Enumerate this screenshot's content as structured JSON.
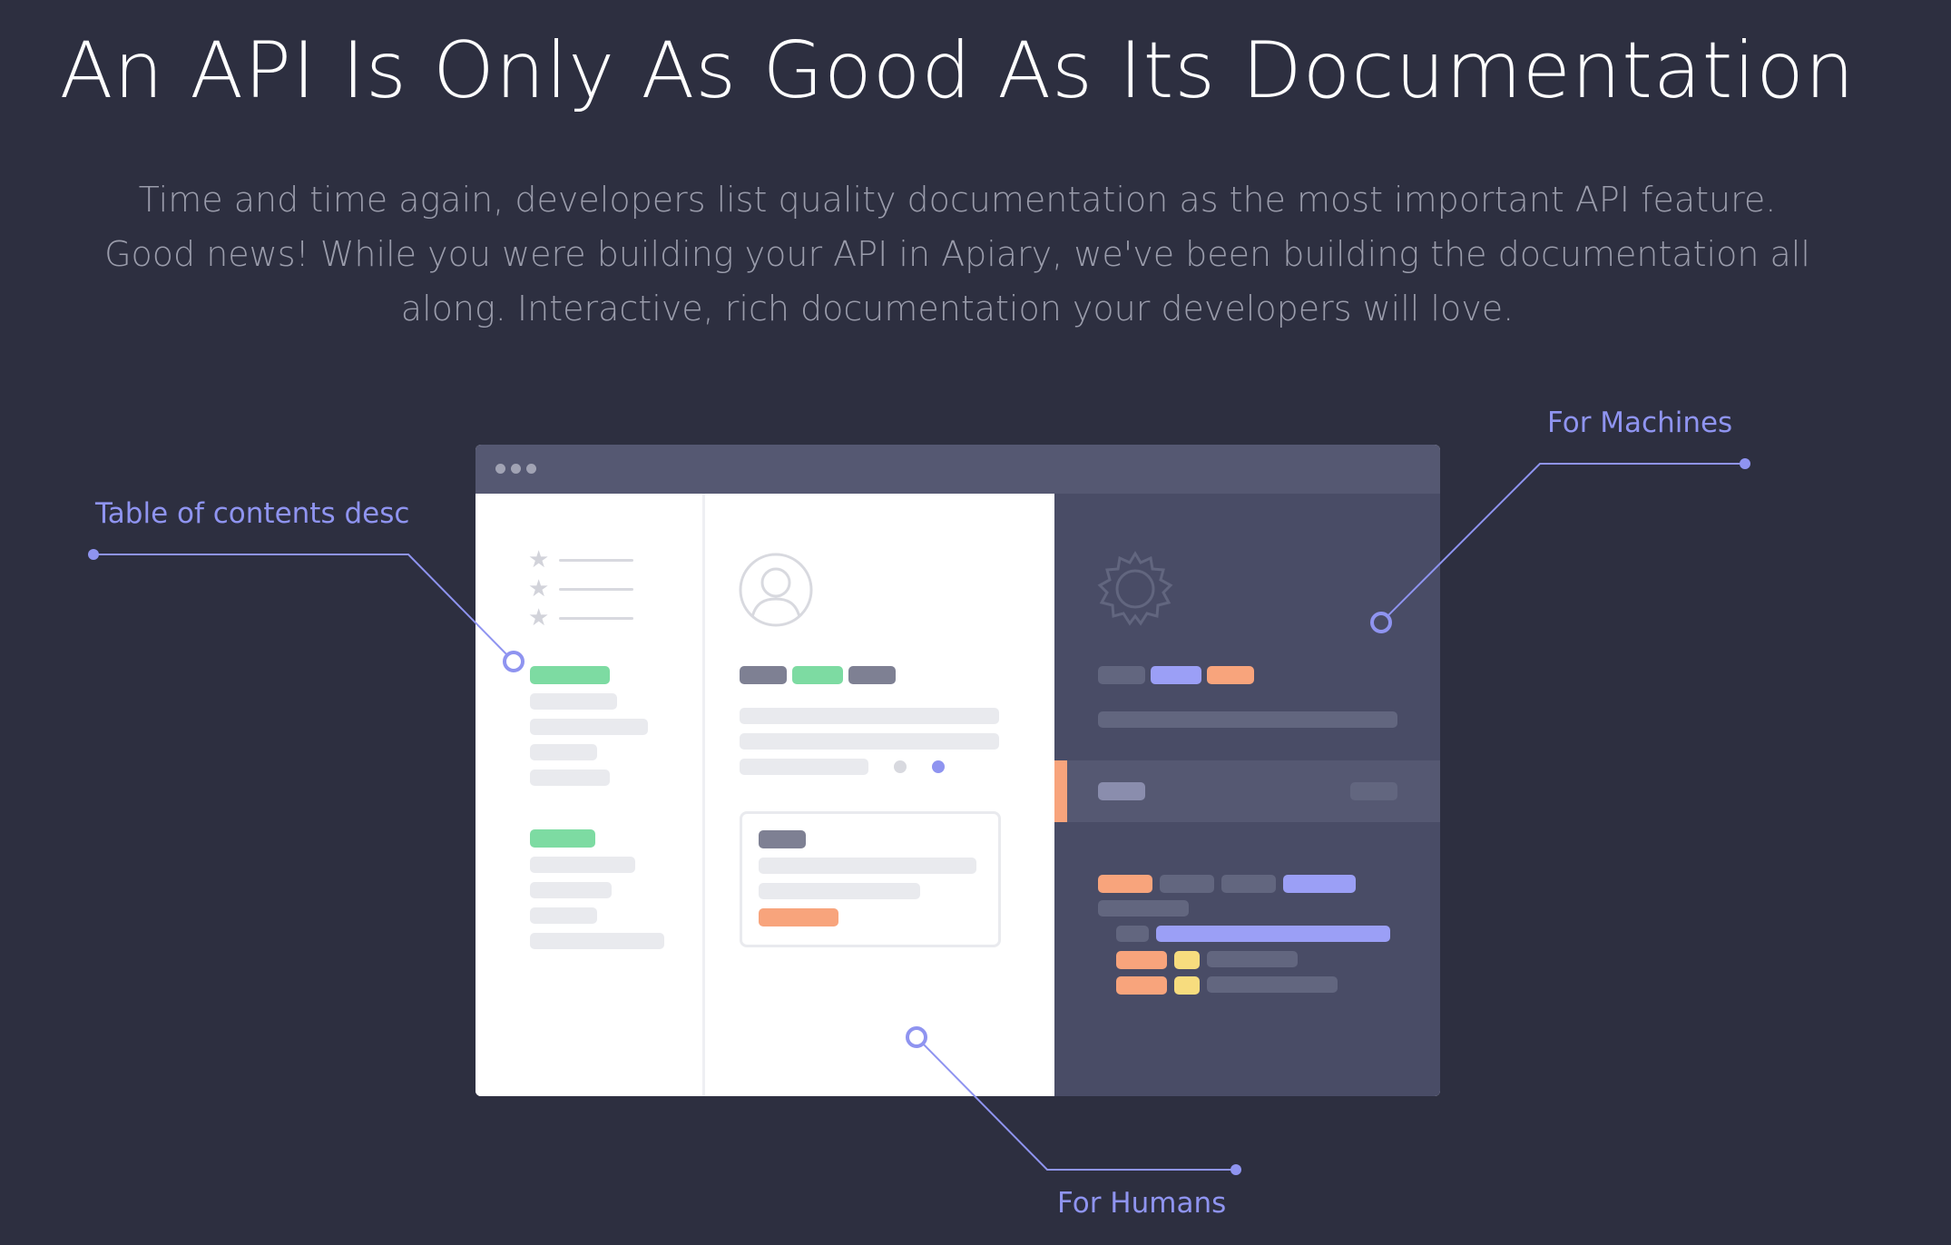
{
  "header": {
    "title": "An API Is Only As Good As Its Documentation",
    "subtitle": "Time and time again, developers list quality documentation as the most important API feature. Good news! While you were building your API in Apiary, we've been building the documentation all along. Interactive, rich documentation your developers will love."
  },
  "callouts": {
    "toc": "Table of contents desc",
    "machines": "For Machines",
    "humans": "For Humans"
  },
  "colors": {
    "background": "#2d2f40",
    "accent": "#8f94f0",
    "green": "#7ddba2",
    "orange": "#f8a47c",
    "purple": "#9b9ff6",
    "yellow": "#f7dc7e"
  },
  "icons": {
    "star": "star-icon",
    "user": "user-avatar-icon",
    "gear": "gear-icon"
  }
}
